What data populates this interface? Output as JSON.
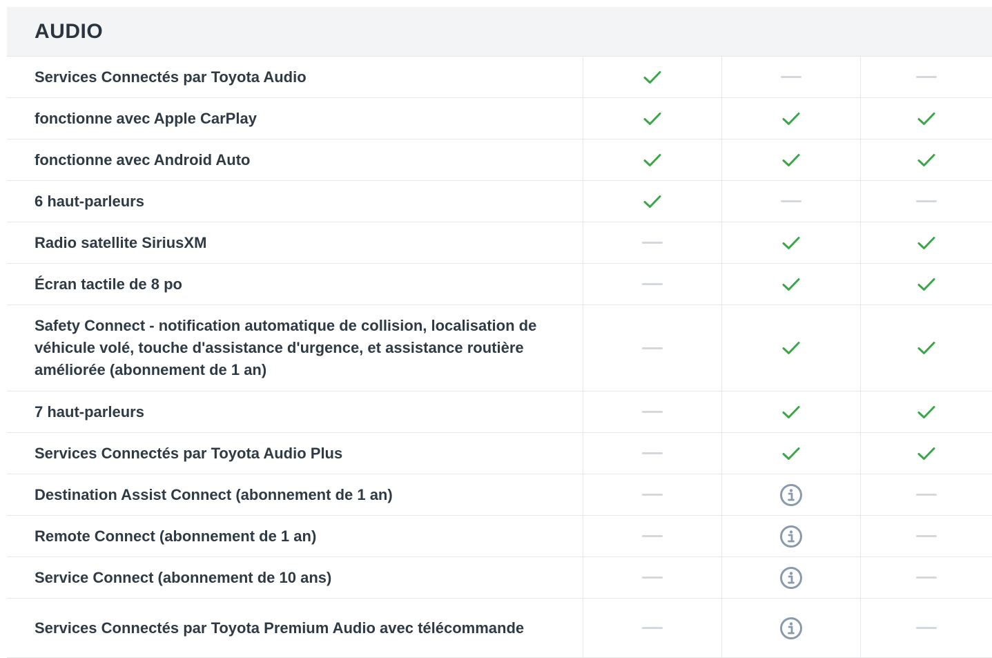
{
  "section": {
    "title": "AUDIO"
  },
  "colors": {
    "check": "#3aa648",
    "dash": "#d4d8dc",
    "info": "#8a9aae"
  },
  "rows": [
    {
      "label": "Services Connectés par Toyota Audio",
      "marks": [
        "check",
        "dash",
        "dash"
      ]
    },
    {
      "label": "fonctionne avec Apple CarPlay",
      "marks": [
        "check",
        "check",
        "check"
      ]
    },
    {
      "label": "fonctionne avec Android Auto",
      "marks": [
        "check",
        "check",
        "check"
      ]
    },
    {
      "label": "6 haut-parleurs",
      "marks": [
        "check",
        "dash",
        "dash"
      ]
    },
    {
      "label": "Radio satellite SiriusXM",
      "marks": [
        "dash",
        "check",
        "check"
      ]
    },
    {
      "label": "Écran tactile de 8 po",
      "marks": [
        "dash",
        "check",
        "check"
      ]
    },
    {
      "label": "Safety Connect - notification automatique de collision, localisation de véhicule volé, touche d'assistance d'urgence, et assistance routière améliorée (abonnement de 1 an)",
      "marks": [
        "dash",
        "check",
        "check"
      ]
    },
    {
      "label": "7 haut-parleurs",
      "marks": [
        "dash",
        "check",
        "check"
      ]
    },
    {
      "label": "Services Connectés par Toyota Audio Plus",
      "marks": [
        "dash",
        "check",
        "check"
      ]
    },
    {
      "label": "Destination Assist Connect (abonnement de 1 an)",
      "marks": [
        "dash",
        "info",
        "dash"
      ]
    },
    {
      "label": "Remote Connect (abonnement de 1 an)",
      "marks": [
        "dash",
        "info",
        "dash"
      ]
    },
    {
      "label": "Service Connect (abonnement de 10 ans)",
      "marks": [
        "dash",
        "info",
        "dash"
      ]
    },
    {
      "label": "Services Connectés par Toyota Premium Audio avec télécommande",
      "marks": [
        "dash",
        "info",
        "dash"
      ]
    }
  ]
}
